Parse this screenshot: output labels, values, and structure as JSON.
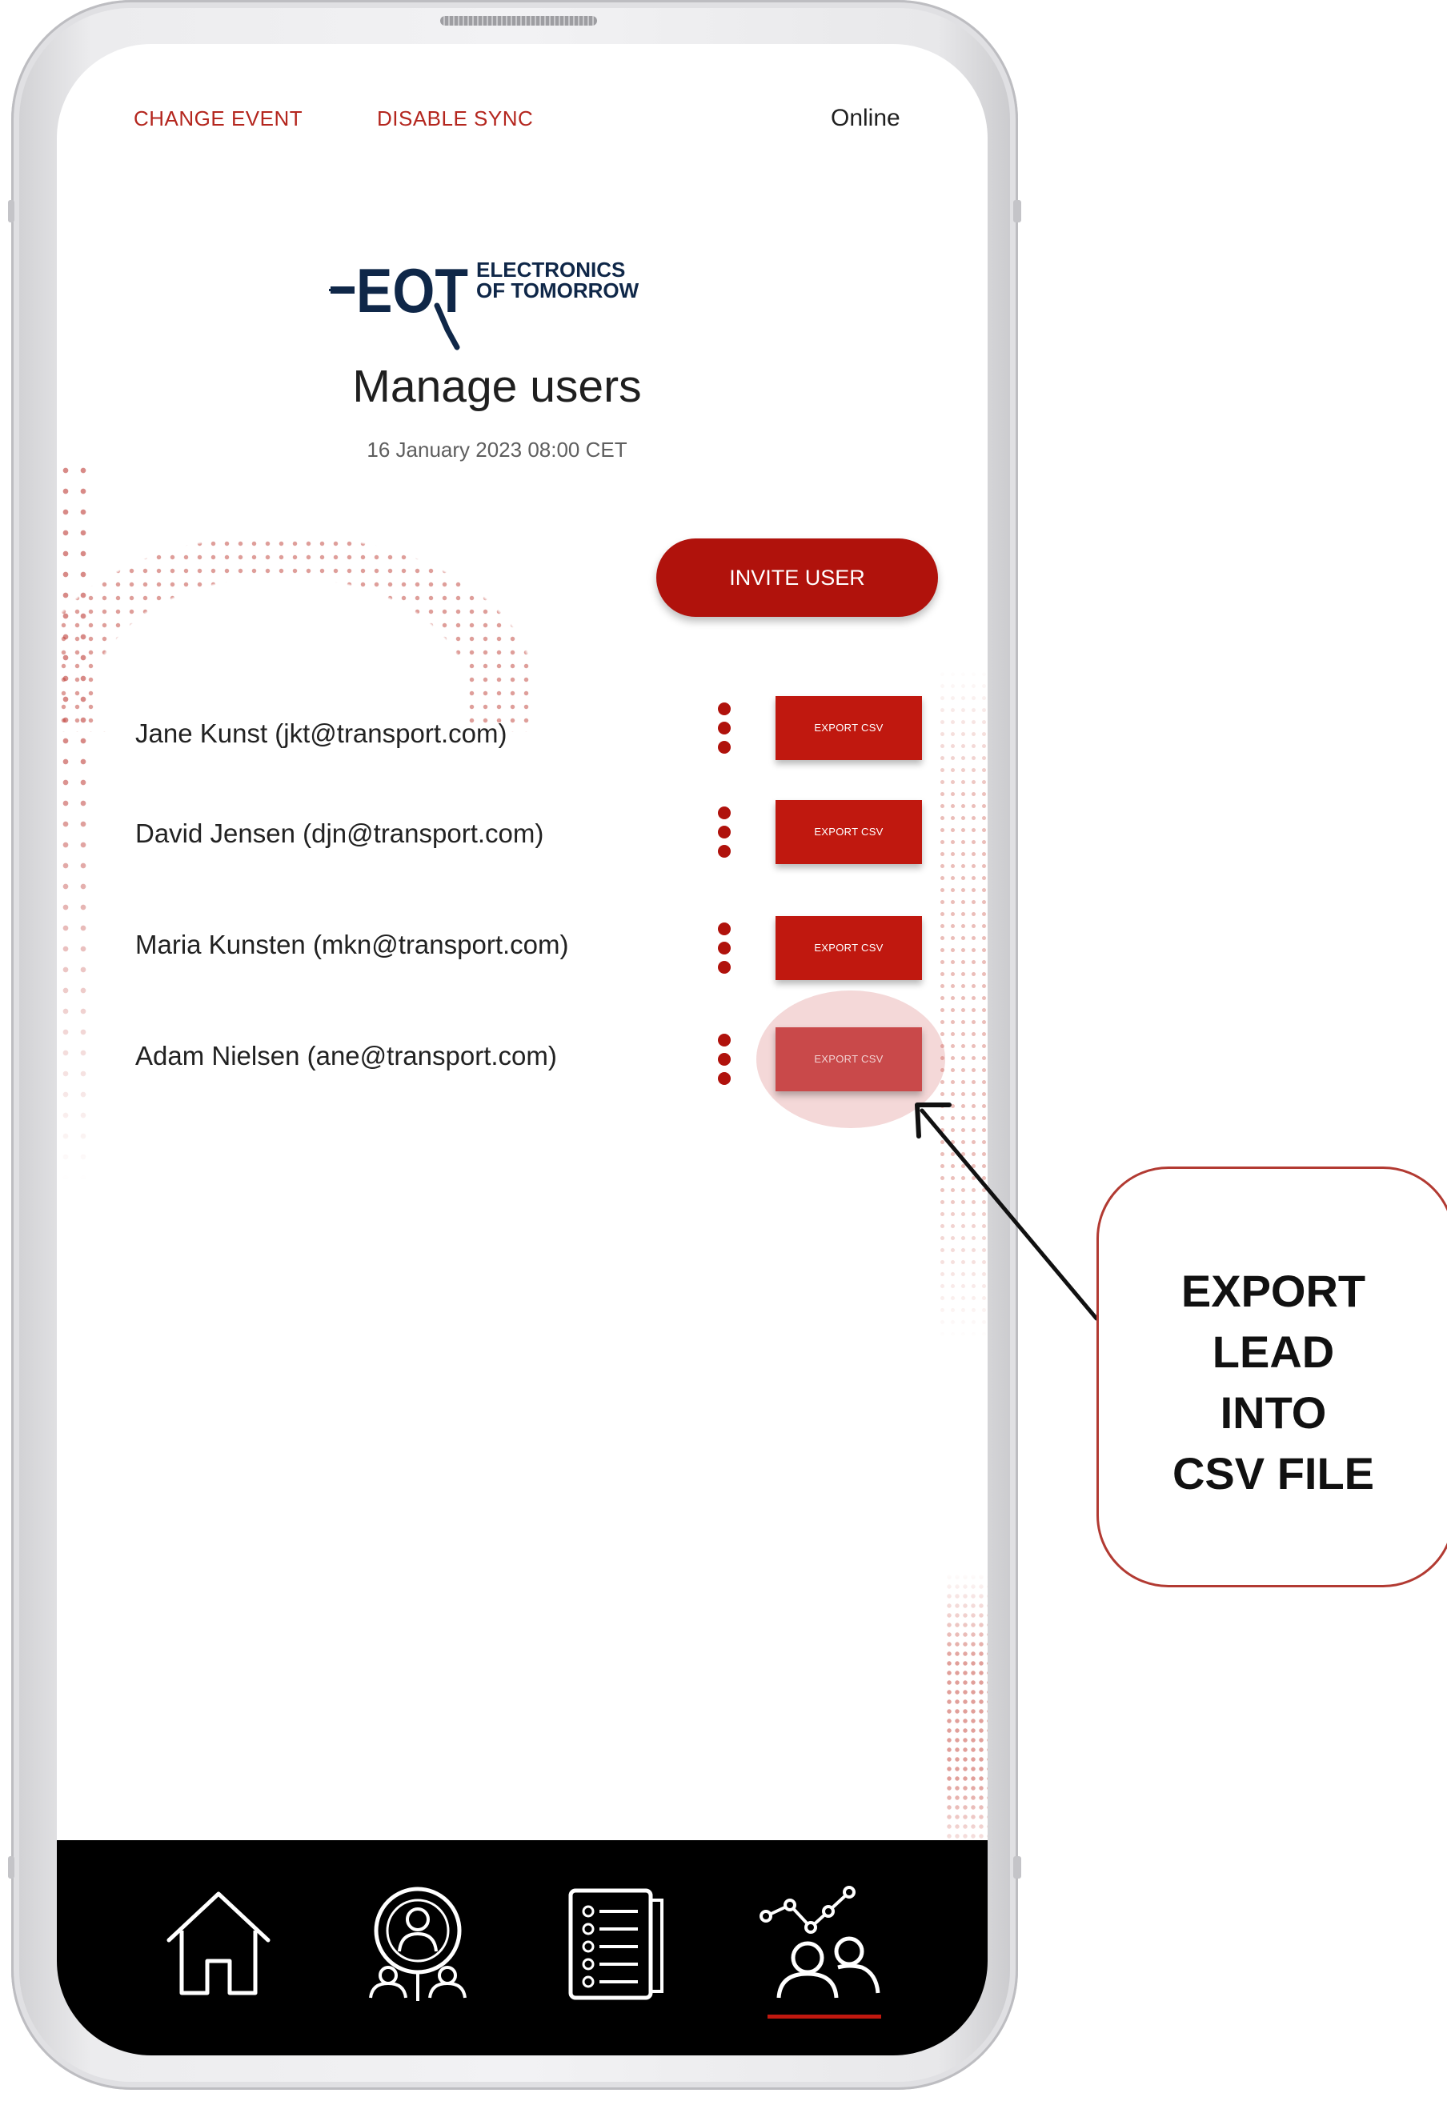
{
  "topbar": {
    "change_event": "CHANGE EVENT",
    "disable_sync": "DISABLE SYNC",
    "status": "Online"
  },
  "logo": {
    "brand": "EOT",
    "line1": "ELECTRONICS",
    "line2": "OF TOMORROW"
  },
  "page": {
    "title": "Manage users",
    "date": "16 January 2023  08:00 CET"
  },
  "invite_button": "INVITE USER",
  "users": [
    {
      "name": "Jane Kunst (jkt@transport.com)",
      "export_label": "EXPORT CSV"
    },
    {
      "name": "David Jensen (djn@transport.com)",
      "export_label": "EXPORT CSV"
    },
    {
      "name": "Maria Kunsten (mkn@transport.com)",
      "export_label": "EXPORT CSV"
    },
    {
      "name": "Adam Nielsen (ane@transport.com)",
      "export_label": "EXPORT CSV"
    }
  ],
  "nav": {
    "items": [
      "home-icon",
      "user-search-icon",
      "checklist-icon",
      "analytics-users-icon"
    ],
    "active": "analytics-users-icon"
  },
  "annotation": {
    "text": "EXPORT\nLEAD\nINTO\nCSV FILE"
  },
  "colors": {
    "accent": "#b0120c",
    "nav_bg": "#000000",
    "callout_border": "#b23a32"
  }
}
